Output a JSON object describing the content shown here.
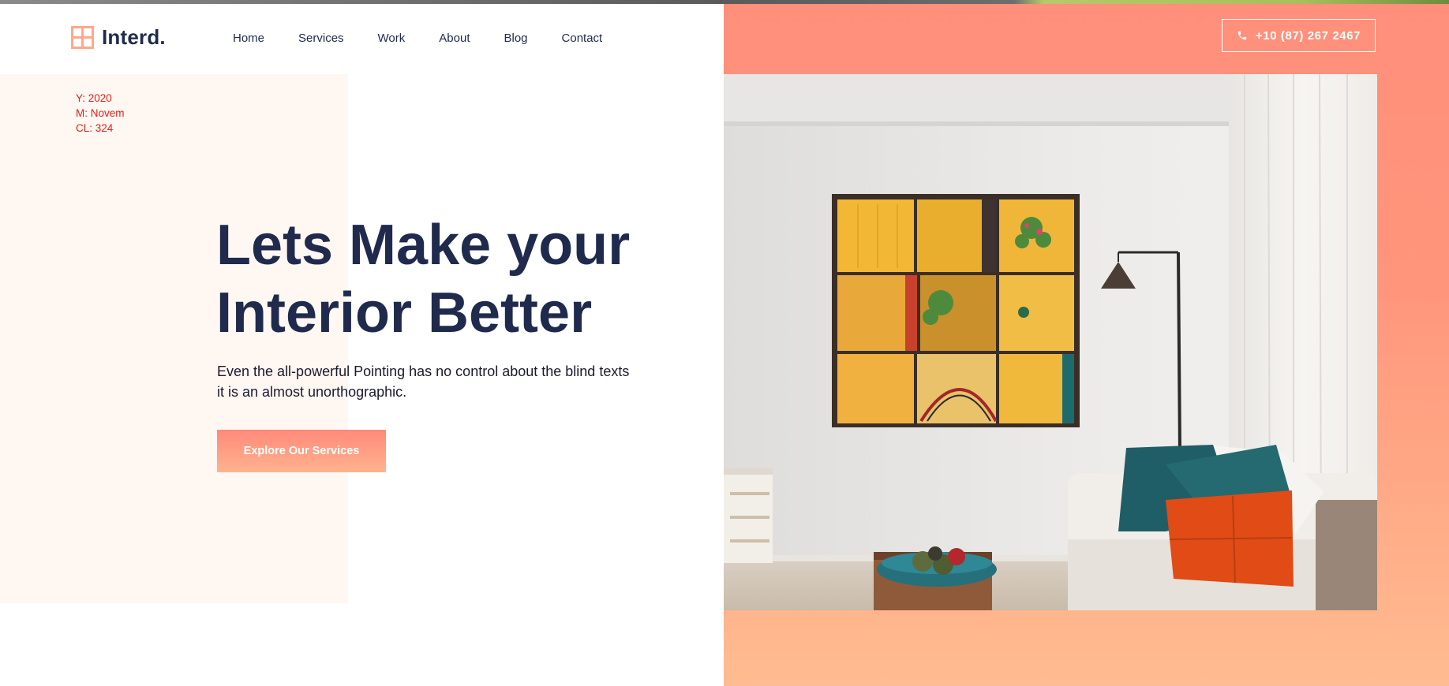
{
  "brand": {
    "name": "Interd.",
    "icon": "grid-window-icon",
    "accent": "#ffa98a"
  },
  "nav": {
    "items": [
      {
        "label": "Home"
      },
      {
        "label": "Services"
      },
      {
        "label": "Work"
      },
      {
        "label": "About"
      },
      {
        "label": "Blog"
      },
      {
        "label": "Contact"
      }
    ]
  },
  "header": {
    "phone": "+10 (87) 267 2467",
    "phone_icon": "phone-icon"
  },
  "debug": {
    "line1": "Y: 2020",
    "line2": "M: Novem",
    "line3": "CL: 324"
  },
  "hero": {
    "title_line1": "Lets Make your",
    "title_line2": "Interior Better",
    "text_line1": "Even the all-powerful Pointing has no control about the blind texts",
    "text_line2": "it is an almost unorthographic.",
    "cta": "Explore Our Services"
  },
  "colors": {
    "navy": "#1f2a4d",
    "coral": "#ff8f7b",
    "peach": "#ffbc90",
    "debug_red": "#e0201a"
  }
}
